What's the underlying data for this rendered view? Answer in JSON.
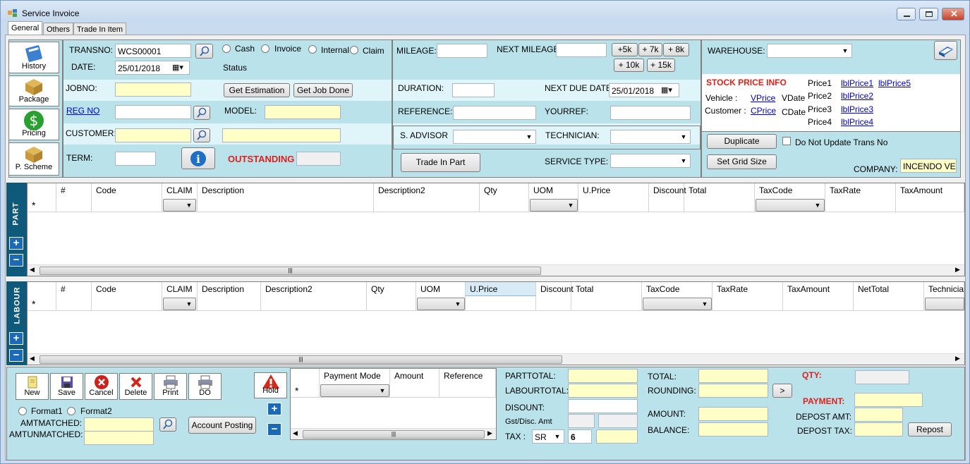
{
  "window": {
    "title": "Service Invoice"
  },
  "tabs": [
    "General",
    "Others",
    "Trade In Item"
  ],
  "sidebar": {
    "items": [
      "History",
      "Package",
      "Pricing",
      "P. Scheme"
    ]
  },
  "header": {
    "transno_label": "TRANSNO:",
    "transno_value": "WCS00001",
    "date_label": "DATE:",
    "date_value": "25/01/2018",
    "pay_types": [
      "Cash",
      "Invoice",
      "Internal",
      "Claim"
    ],
    "status_label": "Status",
    "jobno_label": "JOBNO:",
    "get_estimation": "Get Estimation",
    "get_job_done": "Get Job Done",
    "regno_label": "REG NO",
    "model_label": "MODEL:",
    "customer_label": "CUSTOMER:",
    "term_label": "TERM:",
    "outstanding_label": "OUTSTANDING"
  },
  "middle": {
    "mileage_label": "MILEAGE:",
    "next_mileage_label": "NEXT MILEAGE",
    "mileage_buttons": [
      "+5k",
      "+ 7k",
      "+ 8k",
      "+ 10k",
      "+ 15k"
    ],
    "duration_label": "DURATION:",
    "next_due_label": "NEXT DUE DATE:",
    "next_due_value": "25/01/2018",
    "reference_label": "REFERENCE:",
    "yourref_label": "YOURREF:",
    "advisor_label": "S. ADVISOR",
    "technician_label": "TECHNICIAN:",
    "trade_in_part": "Trade In Part",
    "service_type_label": "SERVICE TYPE:"
  },
  "right": {
    "warehouse_label": "WAREHOUSE:",
    "stock_price_info": "STOCK PRICE INFO",
    "vehicle_label": "Vehicle :",
    "vprice": "VPrice",
    "vdate": "VDate",
    "customer_label": "Customer :",
    "cprice": "CPrice",
    "cdate": "CDate",
    "price_labels": [
      "Price1",
      "Price2",
      "Price3",
      "Price4"
    ],
    "price_links": [
      "lblPrice1",
      "lblPrice2",
      "lblPrice3",
      "lblPrice4",
      "lblPrice5"
    ],
    "duplicate": "Duplicate",
    "do_not_update": "Do Not Update Trans No",
    "set_grid_size": "Set Grid Size",
    "company_label": "COMPANY:",
    "company_value": "INCENDO VEN"
  },
  "part_grid": {
    "side_label": "PART",
    "columns": [
      "#",
      "Code",
      "CLAIM",
      "Description",
      "Description2",
      "Qty",
      "UOM",
      "U.Price",
      "Discount",
      "Total",
      "TaxCode",
      "TaxRate",
      "TaxAmount"
    ],
    "new_row_marker": "*"
  },
  "labour_grid": {
    "side_label": "LABOUR",
    "columns": [
      "#",
      "Code",
      "CLAIM",
      "Description",
      "Description2",
      "Qty",
      "UOM",
      "U.Price",
      "Discount",
      "Total",
      "TaxCode",
      "TaxRate",
      "TaxAmount",
      "NetTotal",
      "Technician"
    ],
    "new_row_marker": "*"
  },
  "toolbar": {
    "buttons": [
      "New",
      "Save",
      "Cancel",
      "Delete",
      "Print",
      "DO"
    ],
    "hold": "Hold"
  },
  "format": {
    "options": [
      "Format1",
      "Format2"
    ]
  },
  "amt": {
    "matched_label": "AMTMATCHED:",
    "unmatched_label": "AMTUNMATCHED:",
    "account_posting": "Account Posting"
  },
  "payment_grid": {
    "columns": [
      "Payment Mode",
      "Amount",
      "Reference"
    ],
    "new_row_marker": "*"
  },
  "totals": {
    "parttotal": "PARTTOTAL:",
    "labourtotal": "LABOURTOTAL:",
    "disount": "DISOUNT:",
    "gst_disc": "Gst/Disc. Amt",
    "tax": "TAX :",
    "tax_code": "SR",
    "tax_rate": "6",
    "total": "TOTAL:",
    "rounding": "ROUNDING:",
    "rounding_btn": ">",
    "amount": "AMOUNT:",
    "balance": "BALANCE:",
    "qty": "QTY:",
    "payment": "PAYMENT:",
    "depost_amt": "DEPOST AMT:",
    "depost_tax": "DEPOST TAX:",
    "repost": "Repost"
  }
}
